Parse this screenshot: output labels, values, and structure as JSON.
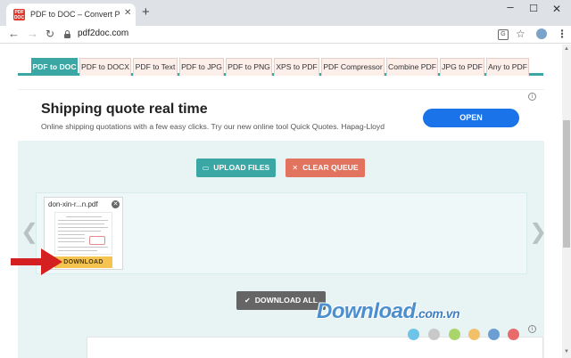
{
  "browser": {
    "tab_title": "PDF to DOC – Convert PDF to Wo",
    "favicon_text": "PDF DOC",
    "tab_close": "✕",
    "new_tab": "+",
    "url": "pdf2doc.com",
    "window_controls": {
      "minimize": "–",
      "maximize": "☐",
      "close": "✕"
    },
    "nav": {
      "back": "←",
      "forward": "→",
      "reload": "↻"
    },
    "icons": {
      "translate": "G",
      "star": "☆",
      "menu": "⋮"
    }
  },
  "tools_nav": {
    "active_index": 0,
    "items": [
      "PDF to DOC",
      "PDF to DOCX",
      "PDF to Text",
      "PDF to JPG",
      "PDF to PNG",
      "XPS to PDF",
      "PDF Compressor",
      "Combine PDF",
      "JPG to PDF",
      "Any to PDF"
    ]
  },
  "ad": {
    "title": "Shipping quote real time",
    "subtitle": "Online shipping quotations with a few easy clicks. Try our new online tool Quick Quotes. Hapag-Lloyd",
    "cta": "OPEN",
    "info_icon": "i"
  },
  "actions": {
    "upload_label": "UPLOAD FILES",
    "upload_icon": "▭",
    "clear_label": "CLEAR QUEUE",
    "clear_icon": "✕",
    "download_all_label": "DOWNLOAD ALL",
    "download_all_icon": "✔"
  },
  "queue": {
    "prev_arrow": "❮",
    "next_arrow": "❯",
    "files": [
      {
        "name": "don-xin-r...n.pdf",
        "remove_icon": "✕",
        "download_label": "DOWNLOAD"
      }
    ]
  },
  "watermark": {
    "text": "Download",
    "suffix": ".com.vn",
    "dot_colors": [
      "#6ec3e9",
      "#c9c9c9",
      "#a8d66a",
      "#f3c06a",
      "#6b9fd4",
      "#e96a6a"
    ]
  },
  "colors": {
    "accent_teal": "#3aa7a5",
    "clear_red": "#e2735f",
    "download_yellow": "#f5c34f",
    "ad_blue": "#1a73e8",
    "annotation_red": "#d42020"
  }
}
